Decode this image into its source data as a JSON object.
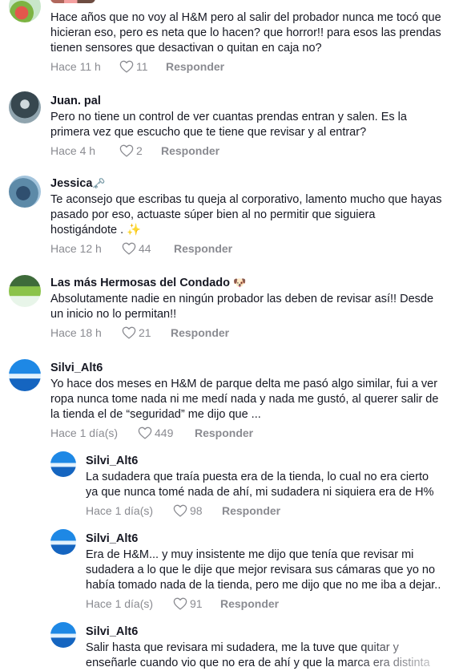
{
  "comments": [
    {
      "username": "",
      "badge": "",
      "text": "Hace años que no voy al H&M pero al salir del probador nunca me tocó que hicieran eso, pero es neta que lo hacen? que horror!! para esos las prendas tienen sensores que desactivan o quitan en caja no?",
      "time": "Hace 11 h",
      "likes": "11",
      "reply_label": "Responder"
    },
    {
      "username": "Juan. pal",
      "badge": "",
      "text": "Pero no tiene un control de ver cuantas prendas entran y salen. Es la primera vez que escucho que te tiene que revisar y al entrar?",
      "time": "Hace 4 h",
      "likes": "2",
      "reply_label": "Responder"
    },
    {
      "username": "Jessica",
      "badge": "🗝️",
      "text": "Te aconsejo que escribas tu queja al corporativo, lamento mucho que hayas pasado por eso, actuaste súper bien al no permitir que siguiera hostigándote . ✨",
      "time": "Hace 12 h",
      "likes": "44",
      "reply_label": "Responder"
    },
    {
      "username": "Las más Hermosas del Condado",
      "badge": "🐶",
      "text": "Absolutamente nadie en ningún probador las deben de revisar así!! Desde un inicio no lo permitan!!",
      "time": "Hace 18 h",
      "likes": "21",
      "reply_label": "Responder"
    },
    {
      "username": "Silvi_Alt6",
      "badge": "",
      "text": "Yo hace dos meses en H&M de parque delta me pasó algo similar, fui a ver ropa nunca tome nada ni me medí nada y nada me gustó, al querer salir de la tienda el de “seguridad” me dijo que ...",
      "time": "Hace 1 día(s)",
      "likes": "449",
      "reply_label": "Responder"
    }
  ],
  "replies": [
    {
      "username": "Silvi_Alt6",
      "text": "La sudadera que traía puesta era de la tienda, lo cual no era cierto ya que nunca tomé nada de ahí, mi sudadera ni siquiera era de H%",
      "time": "Hace 1 día(s)",
      "likes": "98",
      "reply_label": "Responder"
    },
    {
      "username": "Silvi_Alt6",
      "text": "Era de H&M... y muy insistente me dijo que tenía que revisar mi sudadera a lo que le dije que mejor revisara sus cámaras que yo no había tomado nada de la tienda, pero me dijo que no me iba a dejar..",
      "time": "Hace 1 día(s)",
      "likes": "91",
      "reply_label": "Responder"
    },
    {
      "username": "Silvi_Alt6",
      "text": "Salir hasta que revisara mi sudadera, me la tuve que quitar y enseñarle cuando vio que no era de ahí y que la marca era distinta",
      "time": "",
      "likes": "",
      "reply_label": ""
    }
  ],
  "colors": {
    "text_primary": "#161823",
    "text_secondary": "#8a8b91",
    "background": "#ffffff"
  },
  "icons": {
    "like": "heart-outline-icon"
  }
}
